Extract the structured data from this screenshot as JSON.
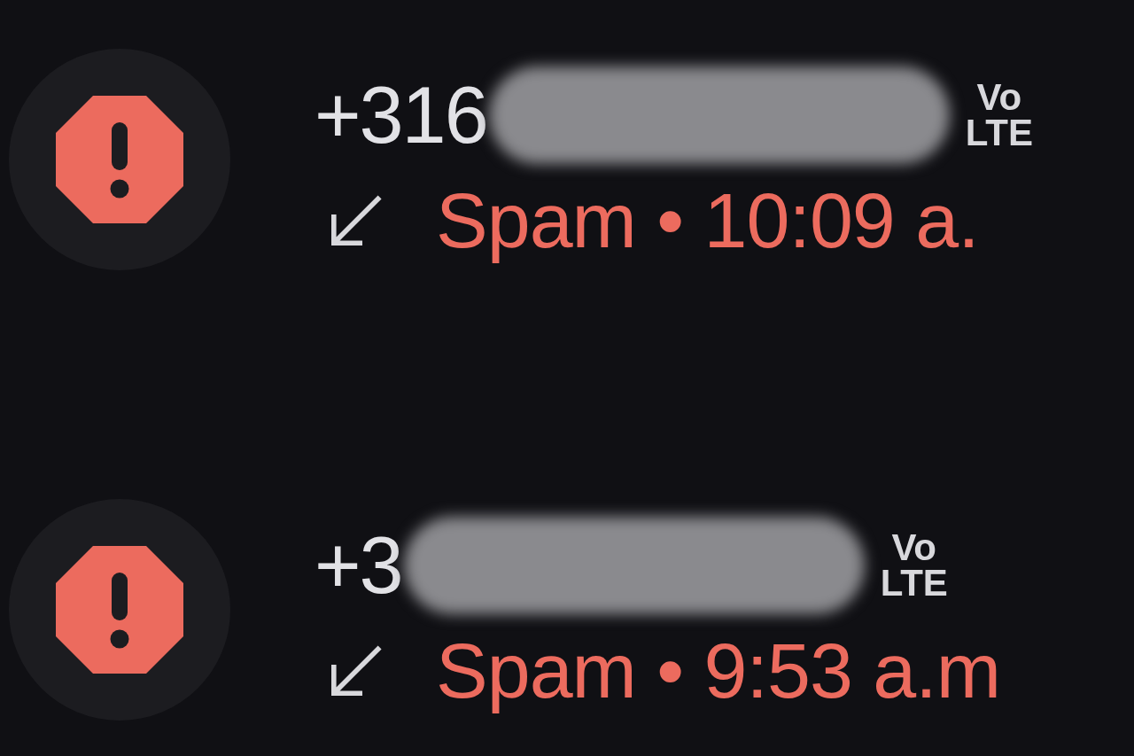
{
  "calls": [
    {
      "number": "+316",
      "network_badge": "Vo\nLTE",
      "incoming": true,
      "kind": "spam",
      "detail": "Spam • 10:09 a."
    },
    {
      "number": "+3",
      "network_badge": "Vo\nLTE",
      "incoming": true,
      "kind": "spam",
      "detail": "Spam • 9:53 a.m"
    }
  ]
}
